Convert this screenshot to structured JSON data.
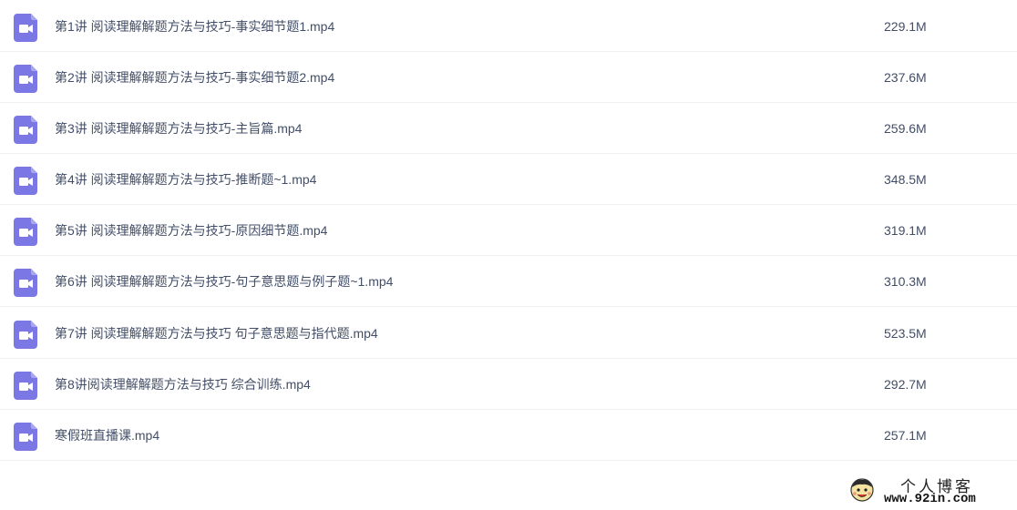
{
  "files": [
    {
      "name": "第1讲 阅读理解解题方法与技巧-事实细节题1.mp4",
      "size": "229.1M",
      "icon": "video-file-icon"
    },
    {
      "name": "第2讲 阅读理解解题方法与技巧-事实细节题2.mp4",
      "size": "237.6M",
      "icon": "video-file-icon"
    },
    {
      "name": "第3讲 阅读理解解题方法与技巧-主旨篇.mp4",
      "size": "259.6M",
      "icon": "video-file-icon"
    },
    {
      "name": "第4讲 阅读理解解题方法与技巧-推断题~1.mp4",
      "size": "348.5M",
      "icon": "video-file-icon"
    },
    {
      "name": "第5讲 阅读理解解题方法与技巧-原因细节题.mp4",
      "size": "319.1M",
      "icon": "video-file-icon"
    },
    {
      "name": "第6讲 阅读理解解题方法与技巧-句子意思题与例子题~1.mp4",
      "size": "310.3M",
      "icon": "video-file-icon"
    },
    {
      "name": "第7讲 阅读理解解题方法与技巧 句子意思题与指代题.mp4",
      "size": "523.5M",
      "icon": "video-file-icon"
    },
    {
      "name": "第8讲阅读理解解题方法与技巧 综合训练.mp4",
      "size": "292.7M",
      "icon": "video-file-icon"
    },
    {
      "name": "寒假班直播课.mp4",
      "size": "257.1M",
      "icon": "video-file-icon"
    }
  ],
  "watermark": {
    "title": "个人博客",
    "url": "www.92in.com",
    "icon": "mascot-logo-icon"
  },
  "colors": {
    "icon_bg": "#7b78e5",
    "text": "#424e67",
    "divider": "#f0f0f0"
  }
}
